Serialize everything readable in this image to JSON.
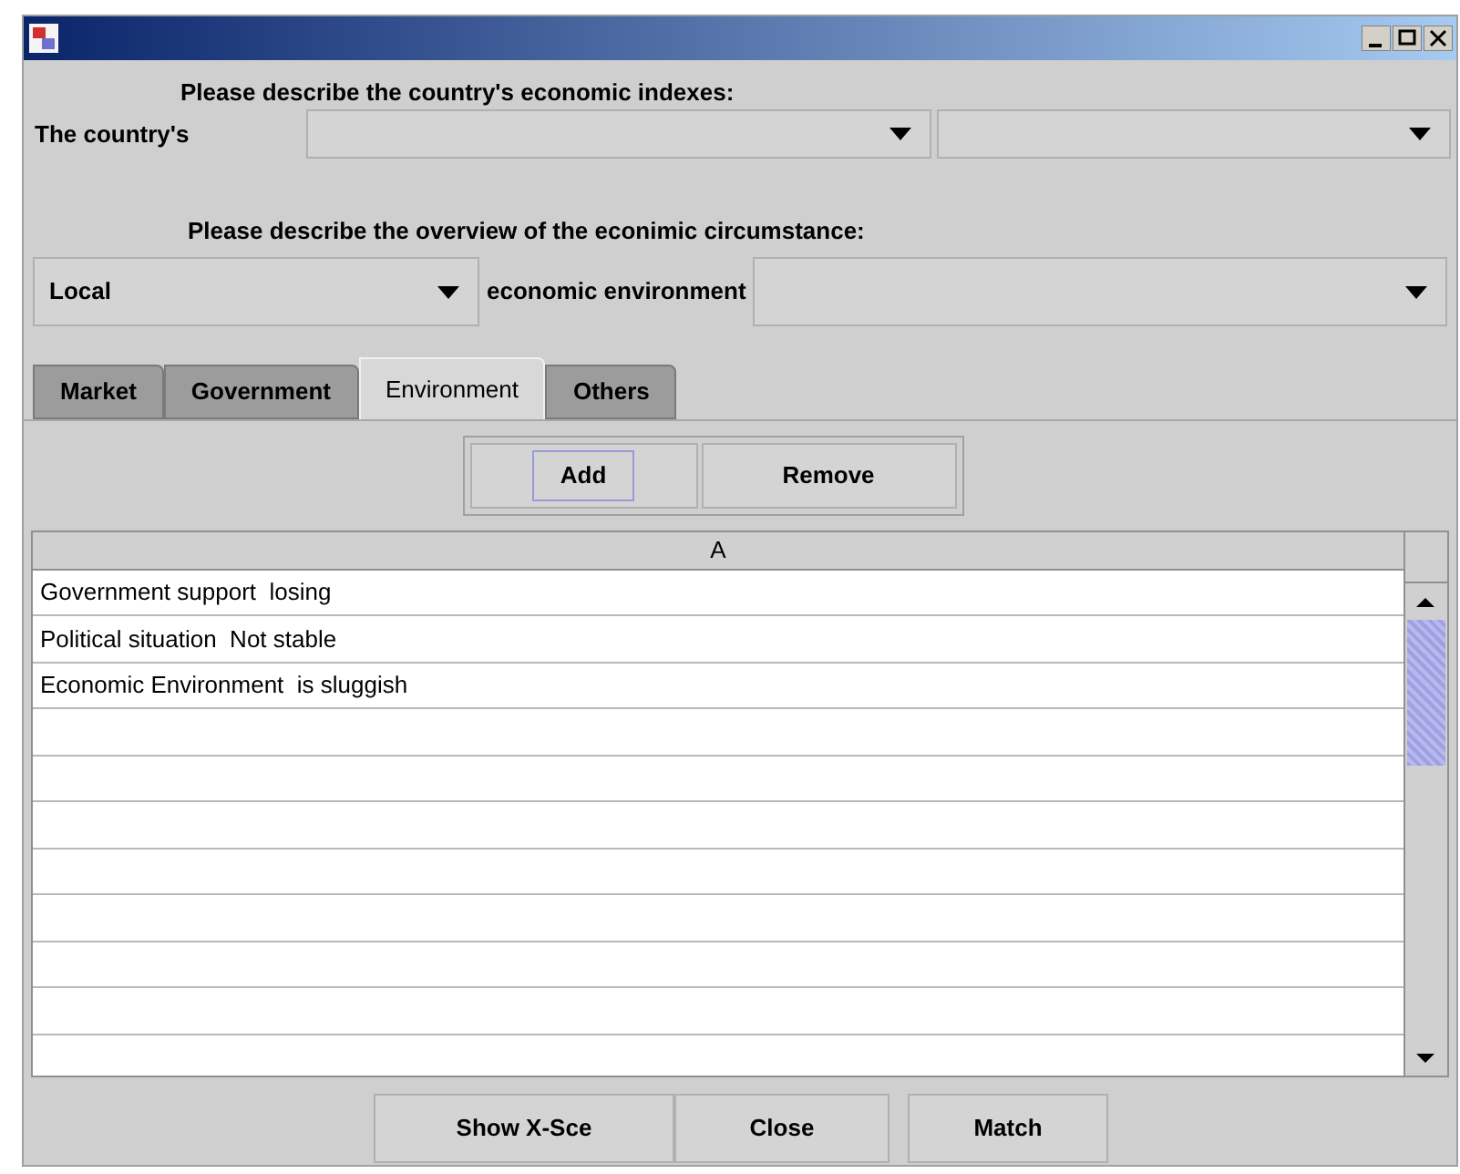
{
  "heading_1": "Please describe the country's economic indexes:",
  "country_label": "The country's",
  "heading_2": "Please describe the overview of the econimic circumstance:",
  "scope_combo": {
    "value": "Local"
  },
  "environment_label": "economic environment",
  "tabs": [
    {
      "label": "Market",
      "selected": false
    },
    {
      "label": "Government",
      "selected": false
    },
    {
      "label": "Environment",
      "selected": true
    },
    {
      "label": "Others",
      "selected": false
    }
  ],
  "edit_buttons": [
    {
      "label": "Add",
      "focused": true
    },
    {
      "label": "Remove",
      "focused": false
    }
  ],
  "table": {
    "columns": [
      "A"
    ],
    "rows": [
      "Government support  losing",
      "Political situation  Not stable",
      "Economic Environment  is sluggish"
    ]
  },
  "footer_buttons": [
    "Show X-Sce",
    "Close",
    "Match"
  ]
}
